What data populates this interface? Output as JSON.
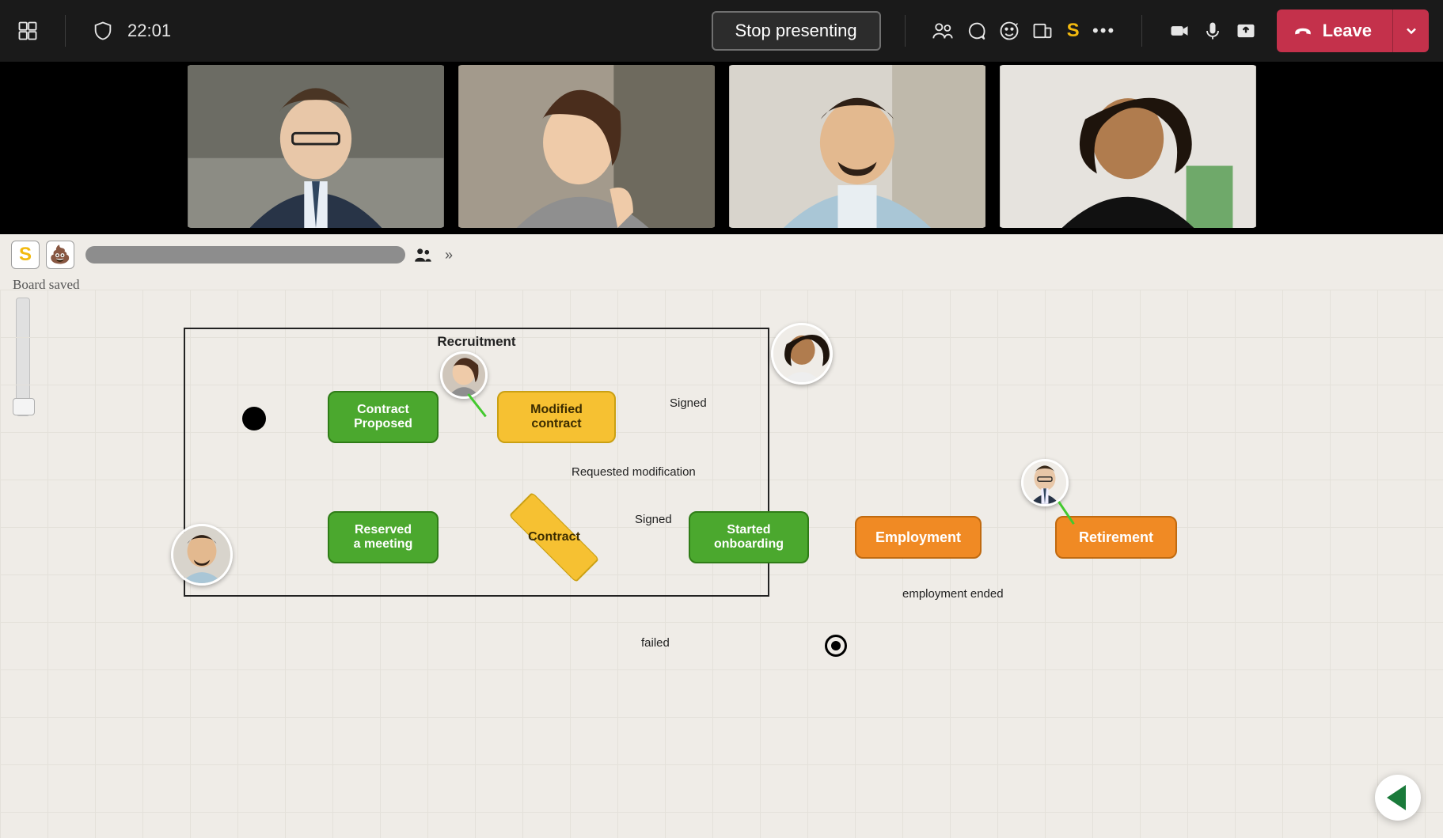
{
  "meeting": {
    "duration": "22:01",
    "stop_presenting_label": "Stop presenting",
    "leave_label": "Leave"
  },
  "board": {
    "status": "Board saved",
    "lane_title": "Recruitment",
    "nodes": {
      "contract_proposed": "Contract\nProposed",
      "modified_contract": "Modified\ncontract",
      "reserved_meeting": "Reserved\na meeting",
      "contract_decision": "Contract",
      "started_onboarding": "Started\nonboarding",
      "employment": "Employment",
      "retirement": "Retirement"
    },
    "edge_labels": {
      "signed_top": "Signed",
      "requested_mod": "Requested modification",
      "signed_mid": "Signed",
      "employment_ended": "employment ended",
      "failed": "failed"
    }
  }
}
